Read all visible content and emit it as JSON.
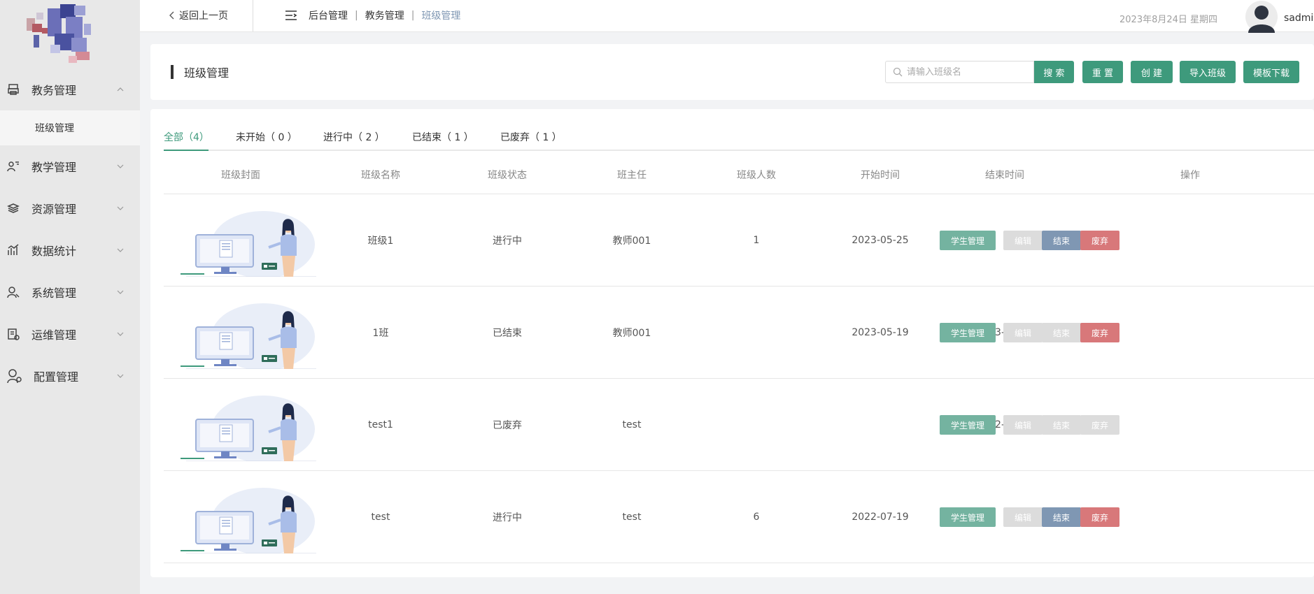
{
  "sidebar": {
    "menu": [
      {
        "label": "教务管理",
        "icon": "printer-icon",
        "expanded": true
      },
      {
        "label": "教学管理",
        "icon": "teacher-icon"
      },
      {
        "label": "资源管理",
        "icon": "layers-icon"
      },
      {
        "label": "数据统计",
        "icon": "bar-chart-icon"
      },
      {
        "label": "系统管理",
        "icon": "user-settings-icon"
      },
      {
        "label": "运维管理",
        "icon": "maintenance-icon"
      },
      {
        "label": "配置管理",
        "icon": "user-gear-icon"
      }
    ],
    "submenu": {
      "label": "班级管理"
    }
  },
  "header": {
    "back_label": "返回上一页",
    "breadcrumb": [
      "后台管理",
      "教务管理",
      "班级管理"
    ],
    "breadcrumb_sep": "|",
    "date": "2023年8月24日 星期四",
    "username": "sadmin"
  },
  "toolbar": {
    "title": "班级管理",
    "search_placeholder": "请输入班级名",
    "search_label": "搜 索",
    "reset_label": "重 置",
    "create_label": "创 建",
    "import_label": "导入班级",
    "template_label": "模板下载"
  },
  "tabs": [
    {
      "label": "全部（4）",
      "active": true
    },
    {
      "label": "未开始（ 0 ）"
    },
    {
      "label": "进行中（ 2 ）"
    },
    {
      "label": "已结束（ 1 ）"
    },
    {
      "label": "已废弃（ 1 ）"
    }
  ],
  "table": {
    "columns": [
      "班级封面",
      "班级名称",
      "班级状态",
      "班主任",
      "班级人数",
      "开始时间",
      "结束时间",
      "操作"
    ],
    "actions": {
      "students": "学生管理",
      "edit": "编辑",
      "end": "结束",
      "discard": "废弃"
    },
    "rows": [
      {
        "name": "班级1",
        "status": "进行中",
        "teacher": "教师001",
        "count": "1",
        "start": "2023-05-25",
        "end": "",
        "end_enabled": true,
        "discard_enabled": true
      },
      {
        "name": "1班",
        "status": "已结束",
        "teacher": "教师001",
        "count": "",
        "start": "2023-05-19",
        "end": "2023-05-19",
        "end_enabled": false,
        "discard_enabled": true
      },
      {
        "name": "test1",
        "status": "已废弃",
        "teacher": "test",
        "count": "",
        "start": "",
        "end": "2022-07-19",
        "end_enabled": false,
        "discard_enabled": false
      },
      {
        "name": "test",
        "status": "进行中",
        "teacher": "test",
        "count": "6",
        "start": "2022-07-19",
        "end": "",
        "end_enabled": true,
        "discard_enabled": true
      }
    ]
  },
  "colors": {
    "primary": "#3e9a7c",
    "info": "#7f97b3",
    "danger": "#d8787a",
    "disabled": "#dcdcdc"
  }
}
